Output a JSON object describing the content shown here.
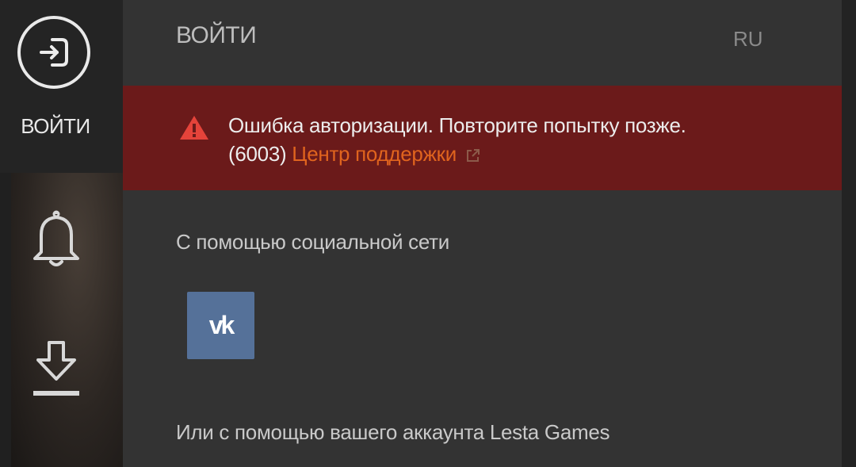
{
  "sidebar": {
    "login_label": "ВОЙТИ",
    "icons": [
      "login-icon",
      "bell-icon",
      "download-icon"
    ]
  },
  "header": {
    "title": "ВОЙТИ",
    "language": "RU"
  },
  "error": {
    "message": "Ошибка авторизации. Повторите попытку позже.",
    "code": "(6003)",
    "support_link": "Центр поддержки",
    "icon": "warning-icon",
    "color": "#6b1a1a",
    "link_color": "#e0641e"
  },
  "social": {
    "label": "С помощью социальной сети",
    "vk_label": "vk",
    "vk_color": "#557199"
  },
  "account": {
    "label": "Или с помощью вашего аккаунта Lesta Games"
  }
}
